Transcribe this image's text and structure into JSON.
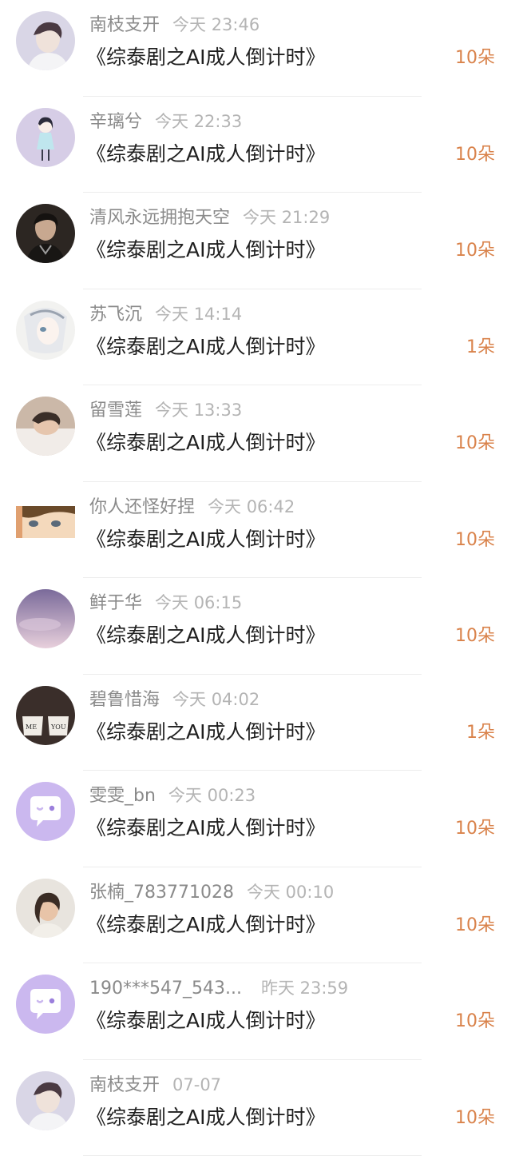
{
  "comments": [
    {
      "name": "南枝支开",
      "time": "今天 23:46",
      "title": "《综泰剧之AI成人倒计时》",
      "gift": "10朵",
      "avatar_icon": "portrait-man-avatar-icon",
      "avatar_colors": [
        "#d9d6e6",
        "#5a4a55"
      ]
    },
    {
      "name": "辛璃兮",
      "time": "今天 22:33",
      "title": "《综泰剧之AI成人倒计时》",
      "gift": "10朵",
      "avatar_icon": "cartoon-girl-avatar-icon",
      "avatar_colors": [
        "#d6cde6",
        "#2b2b3a"
      ]
    },
    {
      "name": "清风永远拥抱天空",
      "time": "今天 21:29",
      "title": "《综泰剧之AI成人倒计时》",
      "gift": "10朵",
      "avatar_icon": "portrait-man-dark-avatar-icon",
      "avatar_colors": [
        "#2c2622",
        "#c8a890"
      ]
    },
    {
      "name": "苏飞沉",
      "time": "今天 14:14",
      "title": "《综泰剧之AI成人倒计时》",
      "gift": "1朵",
      "avatar_icon": "anime-character-avatar-icon",
      "avatar_colors": [
        "#f2f2f0",
        "#9aa3b0"
      ]
    },
    {
      "name": "留雪莲",
      "time": "今天 13:33",
      "title": "《综泰剧之AI成人倒计时》",
      "gift": "10朵",
      "avatar_icon": "portrait-lying-avatar-icon",
      "avatar_colors": [
        "#cbb8a8",
        "#3a2e28"
      ]
    },
    {
      "name": "你人还怪好捏",
      "time": "今天 06:42",
      "title": "《综泰剧之AI成人倒计时》",
      "gift": "10朵",
      "avatar_icon": "anime-eyes-avatar-icon",
      "avatar_colors": [
        "#f4d9bc",
        "#6a4a2a"
      ]
    },
    {
      "name": "鲜于华",
      "time": "今天 06:15",
      "title": "《综泰剧之AI成人倒计时》",
      "gift": "10朵",
      "avatar_icon": "purple-sky-avatar-icon",
      "avatar_colors": [
        "#7a6a9a",
        "#d8c4d8"
      ]
    },
    {
      "name": "碧鲁惜海",
      "time": "今天 04:02",
      "title": "《综泰剧之AI成人倒计时》",
      "gift": "1朵",
      "avatar_icon": "me-you-cups-avatar-icon",
      "avatar_colors": [
        "#3a2e2a",
        "#f0ece6"
      ]
    },
    {
      "name": "雯雯_bn",
      "time": "今天 00:23",
      "title": "《综泰剧之AI成人倒计时》",
      "gift": "10朵",
      "avatar_icon": "chat-bubble-avatar-icon",
      "avatar_colors": [
        "#cbb8ef",
        "#ffffff"
      ]
    },
    {
      "name": "张楠_783771028",
      "time": "今天 00:10",
      "title": "《综泰剧之AI成人倒计时》",
      "gift": "10朵",
      "avatar_icon": "portrait-girl-avatar-icon",
      "avatar_colors": [
        "#e8e4de",
        "#3a2c24"
      ]
    },
    {
      "name": "190***547_543...",
      "time": "昨天 23:59",
      "title": "《综泰剧之AI成人倒计时》",
      "gift": "10朵",
      "avatar_icon": "chat-bubble-avatar-icon",
      "avatar_colors": [
        "#cbb8ef",
        "#ffffff"
      ]
    },
    {
      "name": "南枝支开",
      "time": "07-07",
      "title": "《综泰剧之AI成人倒计时》",
      "gift": "10朵",
      "avatar_icon": "portrait-man-avatar-icon",
      "avatar_colors": [
        "#d9d6e6",
        "#5a4a55"
      ]
    }
  ]
}
